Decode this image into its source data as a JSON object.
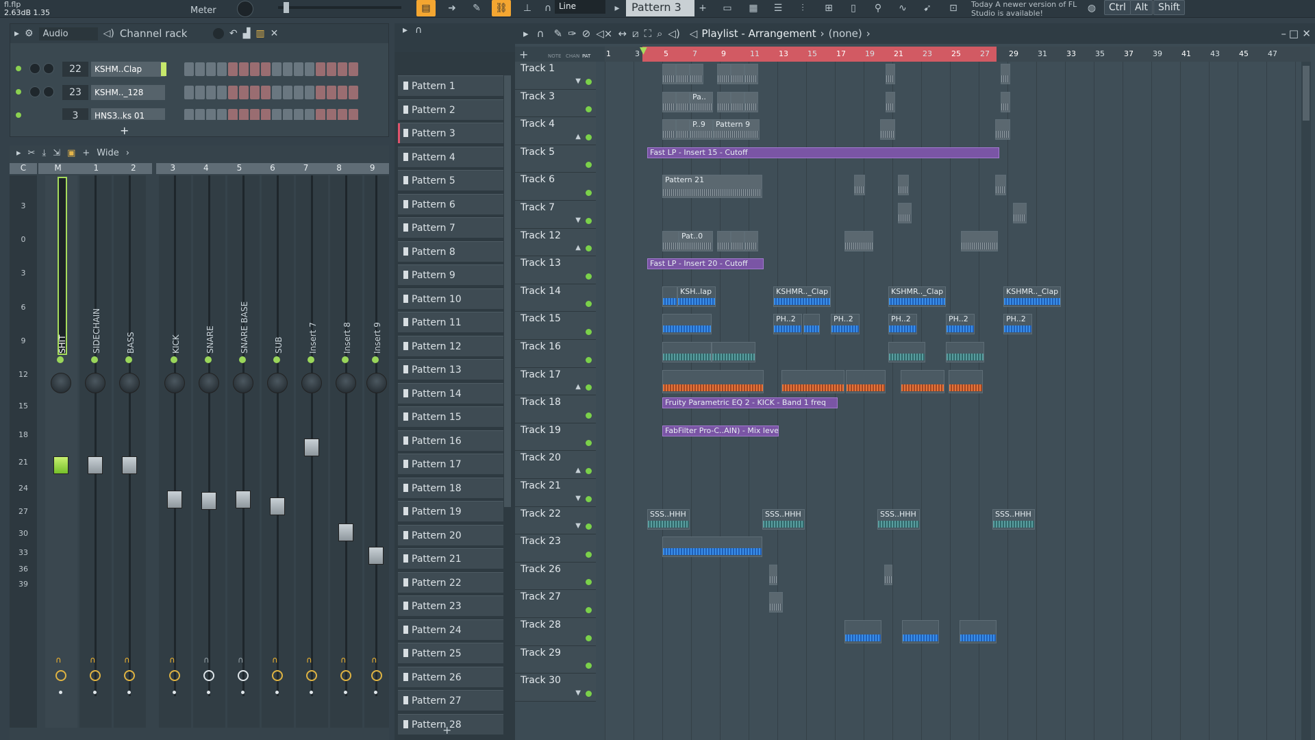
{
  "topbar": {
    "file_name": "fl.flp",
    "level_readout": "2.63dB  1.35",
    "meter_label": "Meter",
    "line_mode": "Line",
    "pattern_selector": "Pattern 3",
    "notice": "Today  A newer version of FL Studio is available!",
    "keys": [
      "Ctrl",
      "Alt",
      "Shift"
    ]
  },
  "channel_rack": {
    "group": "Audio",
    "title": "Channel rack",
    "rows": [
      {
        "num": "22",
        "name": "KSHM..Clap"
      },
      {
        "num": "23",
        "name": "KSHM.._128"
      },
      {
        "num": "3",
        "name": "HNS3..ks 01"
      }
    ]
  },
  "mixer": {
    "view_label": "Wide",
    "header_labels": [
      "C",
      "M",
      "1",
      "2",
      "3",
      "4",
      "5",
      "6",
      "7",
      "8",
      "9"
    ],
    "scale": [
      "3",
      "0",
      "3",
      "6",
      "9",
      "12",
      "15",
      "18",
      "21",
      "24",
      "27",
      "30",
      "33",
      "36",
      "39"
    ],
    "strips": [
      {
        "name": "SHIT"
      },
      {
        "name": "SIDECHAIN"
      },
      {
        "name": "BASS"
      },
      {
        "name": "KICK"
      },
      {
        "name": "SNARE"
      },
      {
        "name": "SNARE BASE"
      },
      {
        "name": "SUB"
      },
      {
        "name": "Insert 7"
      },
      {
        "name": "Insert 8"
      },
      {
        "name": "Insert 9"
      }
    ]
  },
  "picker": {
    "patterns": [
      "Pattern 1",
      "Pattern 2",
      "Pattern 3",
      "Pattern 4",
      "Pattern 5",
      "Pattern 6",
      "Pattern 7",
      "Pattern 8",
      "Pattern 9",
      "Pattern 10",
      "Pattern 11",
      "Pattern 12",
      "Pattern 13",
      "Pattern 14",
      "Pattern 15",
      "Pattern 16",
      "Pattern 17",
      "Pattern 18",
      "Pattern 19",
      "Pattern 20",
      "Pattern 21",
      "Pattern 22",
      "Pattern 23",
      "Pattern 24",
      "Pattern 25",
      "Pattern 26",
      "Pattern 27",
      "Pattern 28"
    ]
  },
  "playlist": {
    "title": "Playlist - Arrangement",
    "breadcrumb_sep": "›",
    "context": "(none)",
    "ruler": [
      "1",
      "3",
      "5",
      "7",
      "9",
      "11",
      "13",
      "15",
      "17",
      "19",
      "21",
      "23",
      "25",
      "27",
      "29",
      "31",
      "33",
      "35",
      "37",
      "39",
      "41",
      "43",
      "45",
      "47"
    ],
    "col_labels": [
      "NOTE",
      "CHAN",
      "PAT"
    ],
    "tracks": [
      "Track 1",
      "Track 3",
      "Track 4",
      "Track 5",
      "Track 6",
      "Track 7",
      "Track 12",
      "Track 13",
      "Track 14",
      "Track 15",
      "Track 16",
      "Track 17",
      "Track 18",
      "Track 19",
      "Track 20",
      "Track 21",
      "Track 22",
      "Track 23",
      "Track 26",
      "Track 27",
      "Track 28",
      "Track 29",
      "Track 30"
    ],
    "clips": {
      "auto1": "Fast LP - Insert 15 - Cutoff",
      "auto2": "Fast LP - Insert 20 - Cutoff",
      "auto3": "Fruity Parametric EQ 2 - KICK - Band 1 freq",
      "auto4": "FabFilter Pro-C..AIN) - Mix level",
      "pat21": "Pattern 21",
      "pat9": "Pattern 9",
      "pa": "Pa..",
      "p9": "P..9",
      "pat0": "Pat..0",
      "kshmr1": "KSH..lap",
      "kshmr2": "KSHMR.._Clap",
      "ph2": "PH..2",
      "sss": "SSS..HHH"
    }
  }
}
